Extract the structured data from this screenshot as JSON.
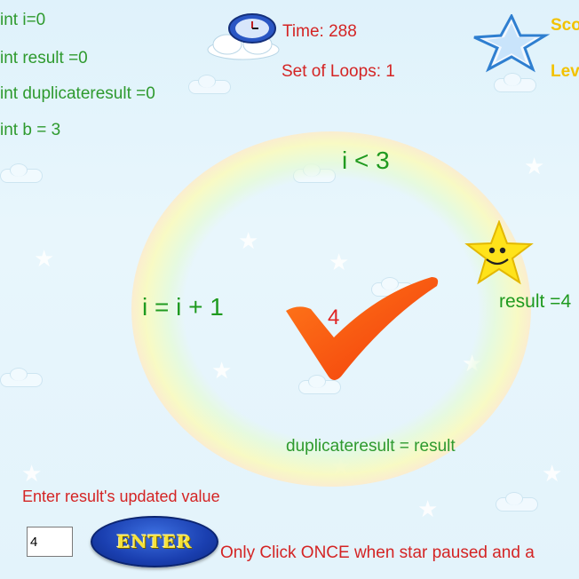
{
  "code_lines": [
    "int i=0",
    "int result =0",
    "int duplicateresult =0",
    "int b = 3"
  ],
  "time": {
    "label": "Time: 288"
  },
  "loops": {
    "label": "Set of Loops: 1"
  },
  "score": {
    "label": "Sco"
  },
  "level": {
    "label": "Lev"
  },
  "loop": {
    "condition": "i < 3",
    "increment": "i = i + 1",
    "result_label": "result =4",
    "duplicate_label": "duplicateresult = result",
    "check_value": "4"
  },
  "prompt": {
    "text": "Enter result's updated value"
  },
  "input": {
    "value": "4"
  },
  "enter_button": {
    "label": "ENTER"
  },
  "instruction": {
    "text": "Only Click ONCE when star paused and a"
  },
  "colors": {
    "code_green": "#2e9a2e",
    "text_red": "#d42424",
    "check_orange": "#ff5a14",
    "score_yellow": "#f2c200"
  }
}
